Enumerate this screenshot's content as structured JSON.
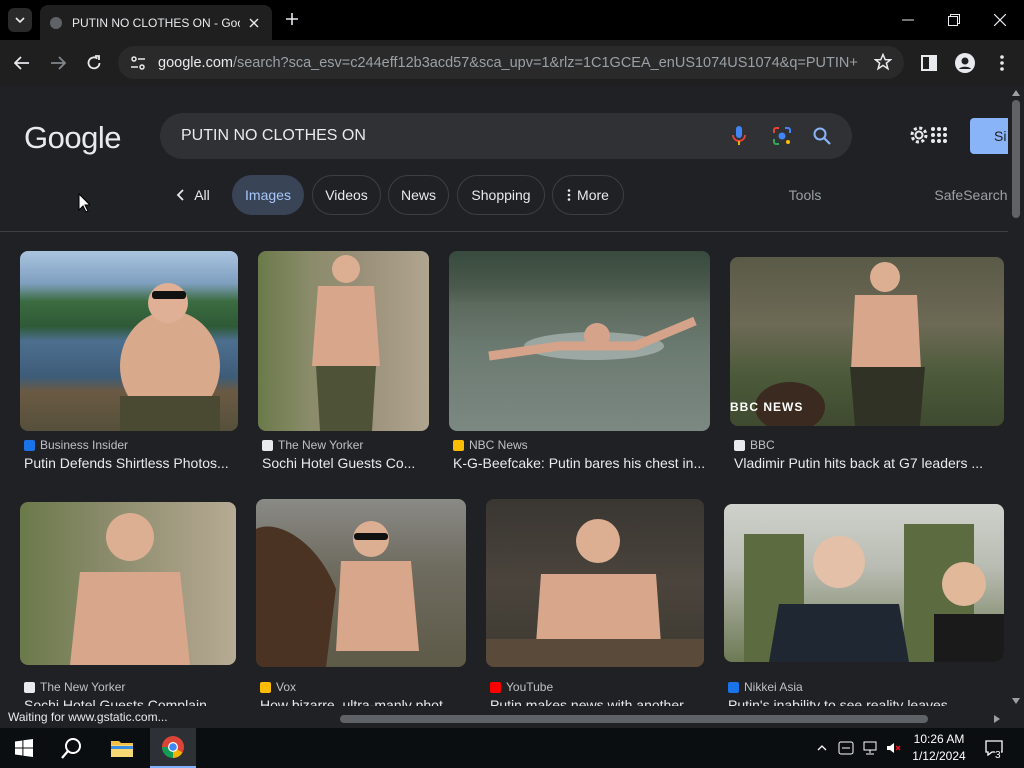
{
  "browser": {
    "tab_title": "PUTIN NO CLOTHES ON - Goog",
    "url_host": "google.com",
    "url_path": "/search?sca_esv=c244eff12b3acd57&sca_upv=1&rlz=1C1GCEA_enUS1074US1074&q=PUTIN+NO+C..."
  },
  "search": {
    "logo": "Google",
    "query": "PUTIN NO CLOTHES ON",
    "signin_label": "Si"
  },
  "chips": {
    "all": "All",
    "images": "Images",
    "videos": "Videos",
    "news": "News",
    "shopping": "Shopping",
    "more": "More",
    "tools": "Tools",
    "safesearch": "SafeSearch"
  },
  "results": [
    {
      "source": "Business Insider",
      "title": "Putin Defends Shirtless Photos...",
      "fav_color": "#1a73e8"
    },
    {
      "source": "The New Yorker",
      "title": "Sochi Hotel Guests Co...",
      "fav_color": "#e8eaed"
    },
    {
      "source": "NBC News",
      "title": "K-G-Beefcake: Putin bares his chest in...",
      "fav_color": "#fbbc04"
    },
    {
      "source": "BBC",
      "title": "Vladimir Putin hits back at G7 leaders ...",
      "fav_color": "#e8eaed"
    },
    {
      "source": "The New Yorker",
      "title": "Sochi Hotel Guests Complain ...",
      "fav_color": "#e8eaed"
    },
    {
      "source": "Vox",
      "title": "How bizarre, ultra-manly phot...",
      "fav_color": "#fbbc04"
    },
    {
      "source": "YouTube",
      "title": "Putin makes news with another...",
      "fav_color": "#ff0000"
    },
    {
      "source": "Nikkei Asia",
      "title": "Putin's inability to see reality leaves ...",
      "fav_color": "#1a73e8"
    }
  ],
  "bbc_watermark": "BBC NEWS",
  "status_text": "Waiting for www.gstatic.com...",
  "taskbar": {
    "time": "10:26 AM",
    "date": "1/12/2024",
    "notif_count": "3"
  }
}
